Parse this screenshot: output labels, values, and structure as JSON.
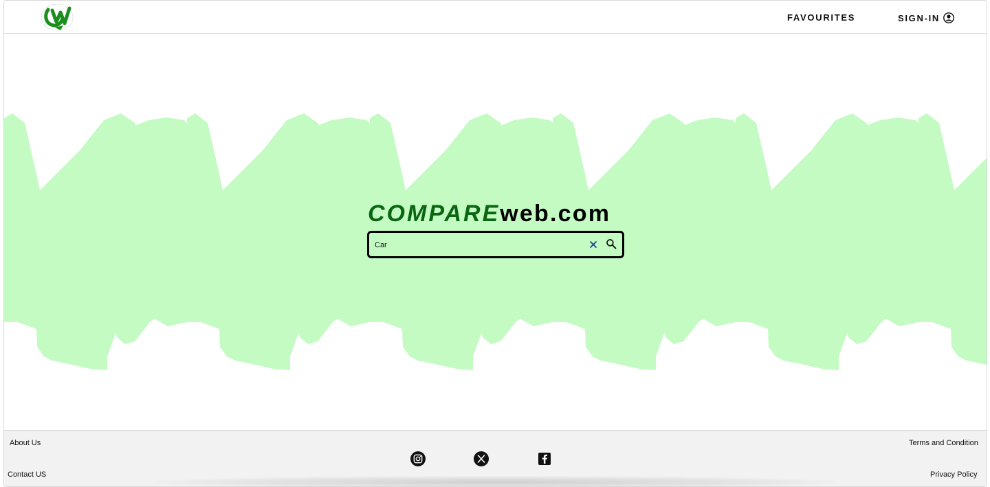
{
  "header": {
    "logo_name": "logo-icon",
    "favourites_label": "FAVOURITES",
    "sign_in_label": "SIGN-IN"
  },
  "brand": {
    "compare": "COMPARE",
    "web": "web.com"
  },
  "search": {
    "value": "Car",
    "placeholder": "",
    "clear_icon": "close-icon",
    "search_icon": "search-icon"
  },
  "footer": {
    "about_label": "About Us",
    "contact_label": "Contact US",
    "terms_label": "Terms and Condition",
    "privacy_label": "Privacy Policy",
    "social_icons": [
      "instagram-icon",
      "x-icon",
      "facebook-icon"
    ]
  },
  "colors": {
    "accent": "#0A6611",
    "hero_green": "#C3FBC3",
    "footer_bg": "#F2F2F2"
  }
}
